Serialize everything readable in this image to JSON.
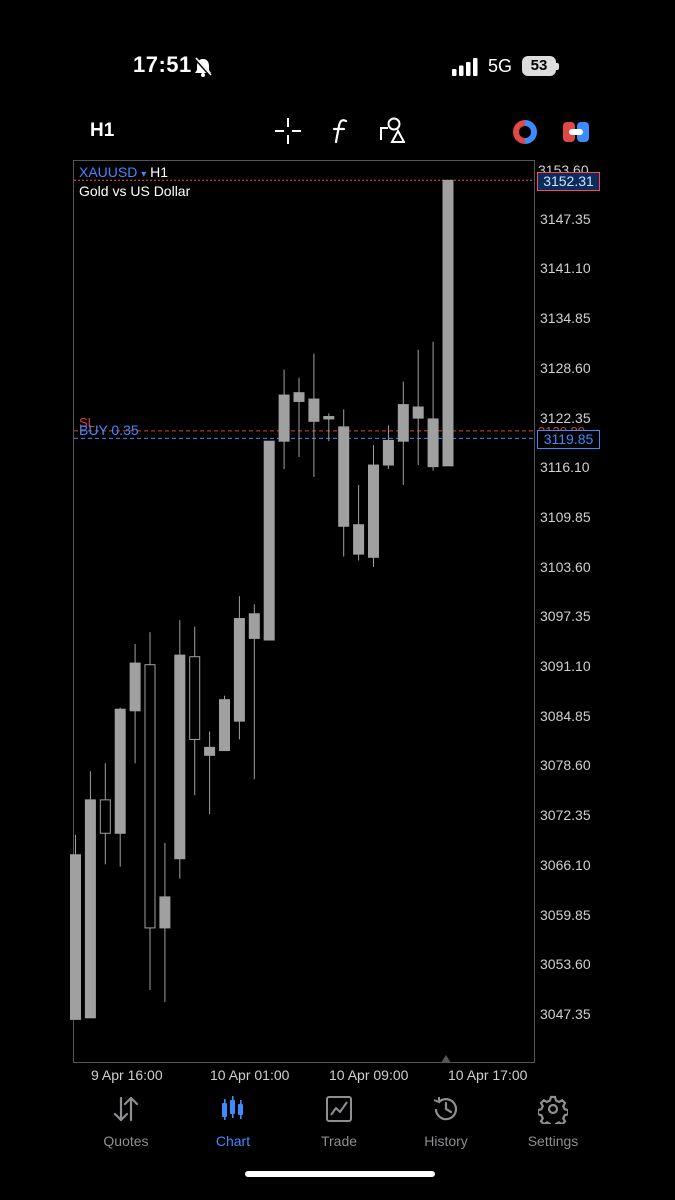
{
  "status_bar": {
    "time": "17:51",
    "network": "5G",
    "battery": "53"
  },
  "toolbar": {
    "timeframe": "H1",
    "icons": [
      "crosshair-icon",
      "function-icon",
      "objects-icon",
      "one-click-trading-icon",
      "toggle-icon"
    ]
  },
  "chart": {
    "symbol": "XAUUSD",
    "symbol_arrow": "▾",
    "timeframe": "H1",
    "description": "Gold vs US Dollar",
    "current_price_tag": "3152.31",
    "buy_price_tag": "3119.85",
    "sl_label": "SL",
    "buy_label": "BUY 0.35",
    "sl_hidden_value": "3120.80",
    "top_hidden_tick": "3153.60"
  },
  "chart_data": {
    "type": "candlestick",
    "symbol": "XAUUSD",
    "timeframe": "H1",
    "y_ticks": [
      "3153.60",
      "3147.35",
      "3141.10",
      "3134.85",
      "3128.60",
      "3122.35",
      "3116.10",
      "3109.85",
      "3103.60",
      "3097.35",
      "3091.10",
      "3084.85",
      "3078.60",
      "3072.35",
      "3066.10",
      "3059.85",
      "3053.60",
      "3047.35"
    ],
    "x_ticks": [
      "9 Apr 16:00",
      "10 Apr 01:00",
      "10 Apr 09:00",
      "10 Apr 17:00"
    ],
    "ylim": [
      3047.35,
      3153.6
    ],
    "candles": [
      {
        "o": 3046.8,
        "h": 3070.0,
        "l": 3046.8,
        "c": 3067.5
      },
      {
        "o": 3047.0,
        "h": 3078.0,
        "l": 3047.0,
        "c": 3074.4
      },
      {
        "o": 3074.4,
        "h": 3079.0,
        "l": 3066.3,
        "c": 3070.2
      },
      {
        "o": 3070.2,
        "h": 3086.0,
        "l": 3066.0,
        "c": 3085.8
      },
      {
        "o": 3085.6,
        "h": 3094.0,
        "l": 3079.0,
        "c": 3091.6
      },
      {
        "o": 3091.4,
        "h": 3095.5,
        "l": 3050.5,
        "c": 3058.3
      },
      {
        "o": 3058.3,
        "h": 3069.0,
        "l": 3049.0,
        "c": 3062.2
      },
      {
        "o": 3067.0,
        "h": 3097.0,
        "l": 3064.5,
        "c": 3092.6
      },
      {
        "o": 3092.4,
        "h": 3096.2,
        "l": 3075.0,
        "c": 3082.0
      },
      {
        "o": 3080.0,
        "h": 3083.0,
        "l": 3072.6,
        "c": 3081.0
      },
      {
        "o": 3080.6,
        "h": 3087.5,
        "l": 3080.6,
        "c": 3087.0
      },
      {
        "o": 3084.3,
        "h": 3100.0,
        "l": 3082.0,
        "c": 3097.2
      },
      {
        "o": 3094.7,
        "h": 3099.0,
        "l": 3077.0,
        "c": 3097.8
      },
      {
        "o": 3094.5,
        "h": 3119.5,
        "l": 3094.5,
        "c": 3119.5
      },
      {
        "o": 3119.5,
        "h": 3128.5,
        "l": 3116.0,
        "c": 3125.3
      },
      {
        "o": 3124.5,
        "h": 3127.5,
        "l": 3117.5,
        "c": 3125.6
      },
      {
        "o": 3122.0,
        "h": 3130.5,
        "l": 3115.0,
        "c": 3124.8
      },
      {
        "o": 3122.3,
        "h": 3123.0,
        "l": 3119.5,
        "c": 3122.6
      },
      {
        "o": 3108.8,
        "h": 3123.5,
        "l": 3105.0,
        "c": 3121.3
      },
      {
        "o": 3105.3,
        "h": 3114.0,
        "l": 3104.5,
        "c": 3109.0
      },
      {
        "o": 3104.9,
        "h": 3119.0,
        "l": 3103.7,
        "c": 3116.5
      },
      {
        "o": 3116.5,
        "h": 3121.5,
        "l": 3116.0,
        "c": 3119.6
      },
      {
        "o": 3119.5,
        "h": 3127.0,
        "l": 3114.0,
        "c": 3124.1
      },
      {
        "o": 3122.4,
        "h": 3131.0,
        "l": 3116.5,
        "c": 3123.8
      },
      {
        "o": 3116.3,
        "h": 3132.0,
        "l": 3115.8,
        "c": 3122.3
      },
      {
        "o": 3116.4,
        "h": 3152.3,
        "l": 3116.4,
        "c": 3152.3
      }
    ],
    "price_lines": [
      {
        "label": "current",
        "value": 3152.31,
        "color": "#ff4a4a"
      },
      {
        "label": "SL",
        "value": 3120.8,
        "color": "#d84040"
      },
      {
        "label": "BUY 0.35",
        "value": 3119.85,
        "color": "#3c8bff"
      }
    ],
    "grid": false
  },
  "tabbar": {
    "tabs": [
      {
        "label": "Quotes",
        "icon": "quotes-arrows-icon"
      },
      {
        "label": "Chart",
        "icon": "candlestick-chart-icon"
      },
      {
        "label": "Trade",
        "icon": "trade-chart-icon"
      },
      {
        "label": "History",
        "icon": "history-clock-icon"
      },
      {
        "label": "Settings",
        "icon": "gear-icon"
      }
    ],
    "active": "Chart"
  },
  "colors": {
    "accent": "#3c8bff",
    "bull_candle": "#a0a0a0",
    "bear_candle": "#000000",
    "sl": "#d84040",
    "current_price": "#ff4a4a"
  }
}
